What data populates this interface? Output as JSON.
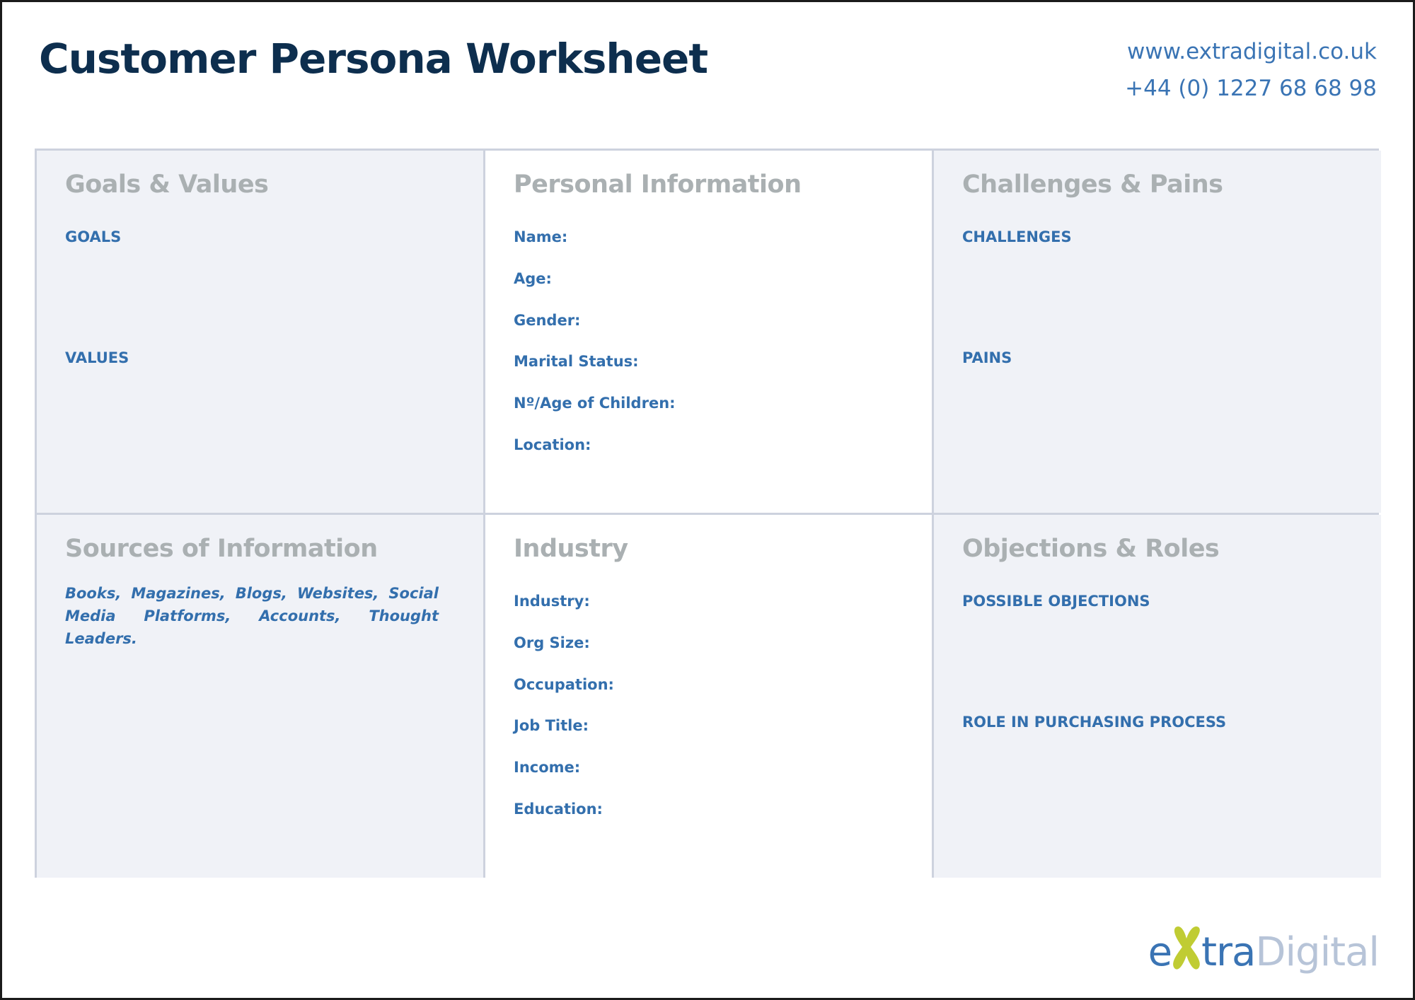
{
  "header": {
    "title": "Customer Persona Worksheet",
    "website": "www.extradigital.co.uk",
    "phone": "+44 (0) 1227 68 68 98"
  },
  "sections": {
    "goals_values": {
      "heading": "Goals & Values",
      "labels": [
        "GOALS",
        "VALUES"
      ]
    },
    "personal_information": {
      "heading": "Personal Information",
      "fields": [
        "Name:",
        "Age:",
        "Gender:",
        "Marital Status:",
        "Nº/Age of Children:",
        "Location:"
      ]
    },
    "challenges_pains": {
      "heading": "Challenges & Pains",
      "labels": [
        "CHALLENGES",
        "PAINS"
      ]
    },
    "sources_of_information": {
      "heading": "Sources of Information",
      "text": "Books, Magazines, Blogs, Websites, Social Media Platforms, Accounts, Thought Leaders."
    },
    "industry": {
      "heading": "Industry",
      "fields": [
        "Industry:",
        "Org Size:",
        "Occupation:",
        "Job Title:",
        "Income:",
        "Education:"
      ]
    },
    "objections_roles": {
      "heading": "Objections & Roles",
      "labels": [
        "POSSIBLE OBJECTIONS",
        "ROLE IN PURCHASING PROCESS"
      ]
    }
  },
  "logo": {
    "part_e": "e",
    "part_tra": "tra",
    "part_digital": "Digital",
    "icon": "x-blob-icon"
  },
  "colors": {
    "title": "#0d2e4e",
    "accent_blue": "#336fad",
    "heading_gray": "#aab0b2",
    "cell_fill": "#f0f2f7",
    "grid_border": "#cdd2de",
    "logo_green": "#c0cc33"
  }
}
